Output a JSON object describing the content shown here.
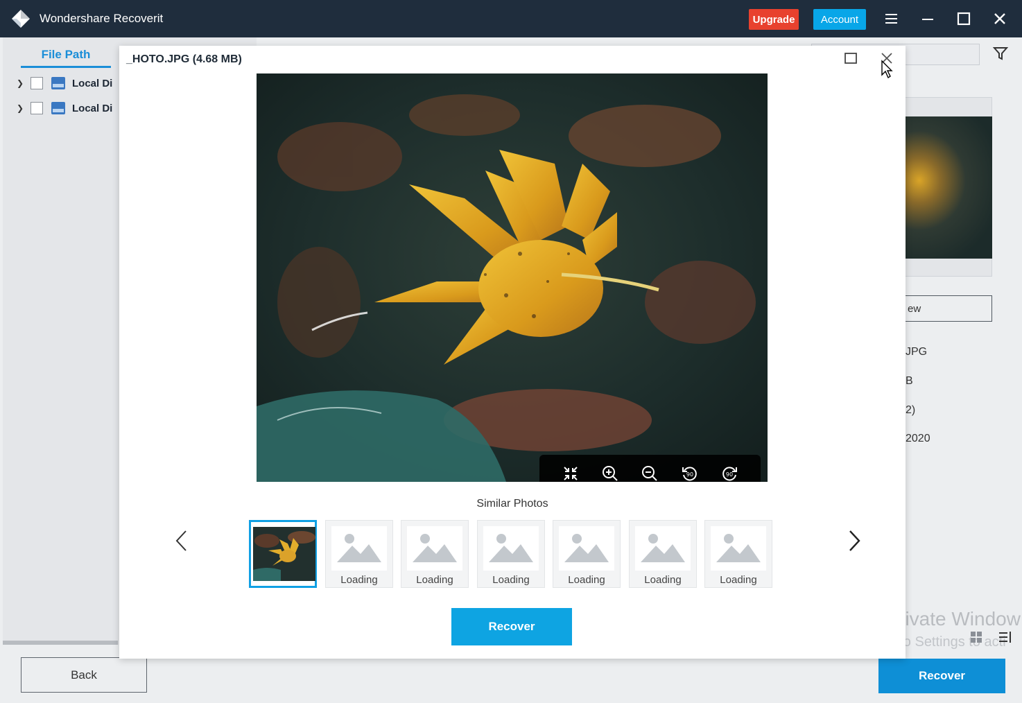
{
  "window": {
    "title": "Wondershare Recoverit",
    "upgrade_label": "Upgrade",
    "account_label": "Account",
    "accent": "#08a6e8",
    "upgrade_color": "#e8412e"
  },
  "sidebar": {
    "tab_label": "File Path",
    "tree": [
      {
        "label": "Local Di"
      },
      {
        "label": "Local Di"
      }
    ]
  },
  "details": {
    "preview_label": "ew",
    "info": [
      "JPG",
      "B",
      "2)",
      "2020"
    ]
  },
  "watermark": {
    "line1": "Activate Window",
    "line2": "Go to Settings to acti"
  },
  "footer": {
    "back_label": "Back",
    "recover_label": "Recover"
  },
  "preview_modal": {
    "title": "_HOTO.JPG (4.68 MB)",
    "toolbar_icons": [
      "fit-screen-icon",
      "zoom-in-icon",
      "zoom-out-icon",
      "rotate-left-icon",
      "rotate-right-icon"
    ],
    "similar_label": "Similar Photos",
    "thumbnails": [
      {
        "status": ""
      },
      {
        "status": "Loading"
      },
      {
        "status": "Loading"
      },
      {
        "status": "Loading"
      },
      {
        "status": "Loading"
      },
      {
        "status": "Loading"
      },
      {
        "status": "Loading"
      }
    ],
    "recover_label": "Recover"
  }
}
